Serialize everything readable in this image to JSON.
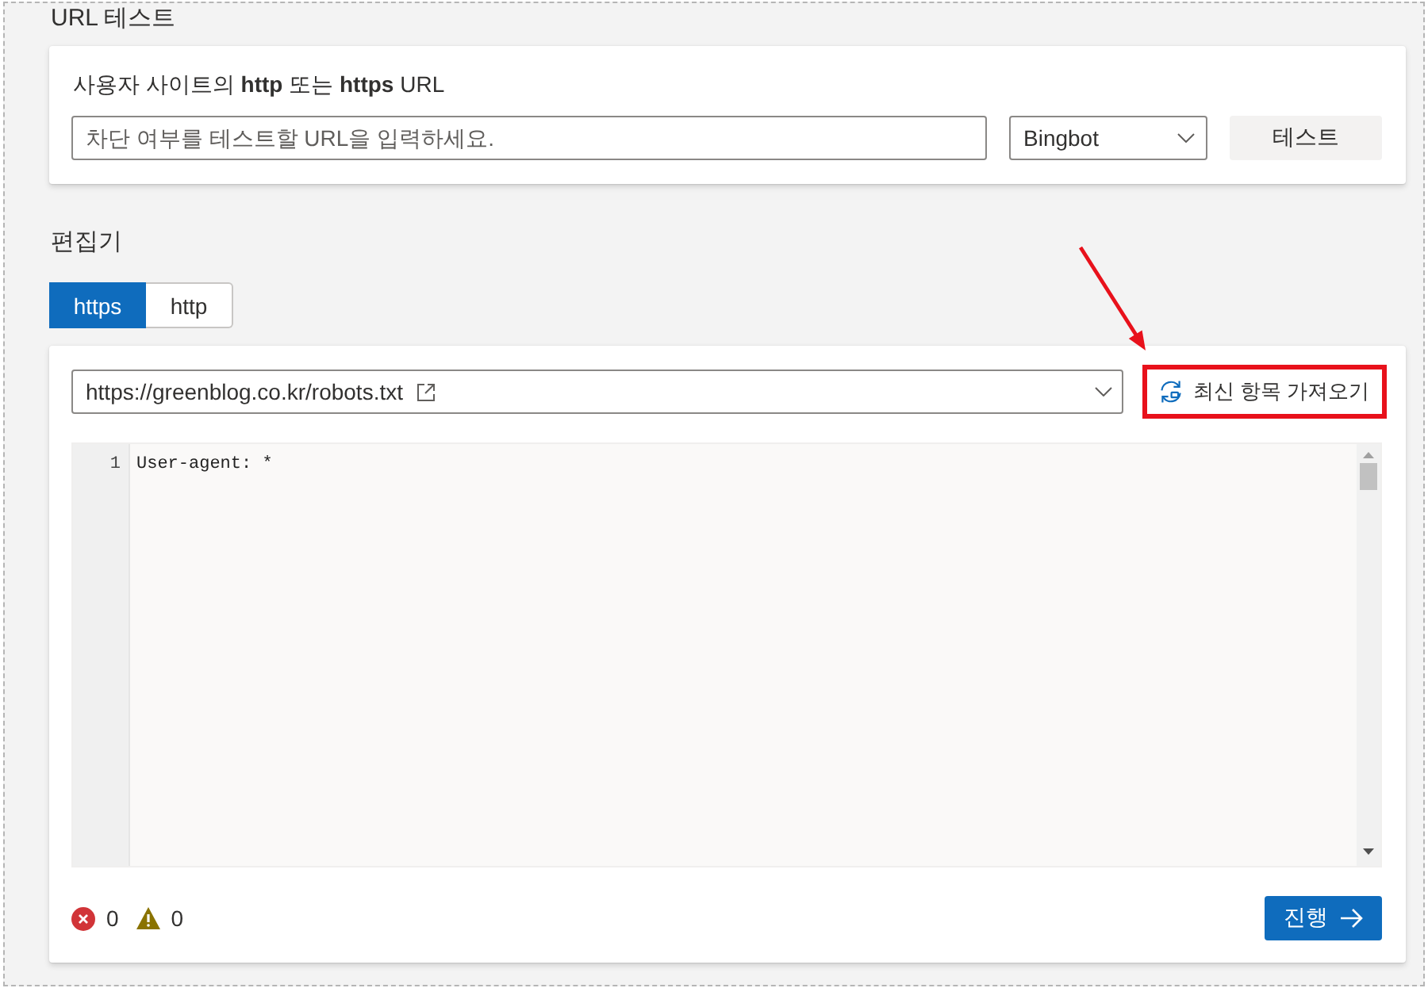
{
  "url_test": {
    "title": "URL 테스트",
    "label": "사용자 사이트의 **http** 또는 **https** URL",
    "url_field": {
      "placeholder": "차단 여부를 테스트할 URL을 입력하세요."
    },
    "crawler_dropdown": {
      "value": "Bingbot"
    },
    "test_button": {
      "label": "테스트"
    }
  },
  "editor": {
    "title": "편집기",
    "tabs": [
      {
        "label": "https",
        "selected": true
      },
      {
        "label": "http",
        "selected": false
      }
    ],
    "url_dropdown": {
      "value": "https://greenblog.co.kr/robots.txt"
    },
    "fetch_button": {
      "label": "최신 항목 가져오기",
      "highlighted": true
    },
    "lines": [
      {
        "number": "1",
        "text": "User-agent: *"
      }
    ],
    "error_count": "0",
    "warning_count": "0",
    "proceed_button": {
      "label": "진행"
    }
  }
}
